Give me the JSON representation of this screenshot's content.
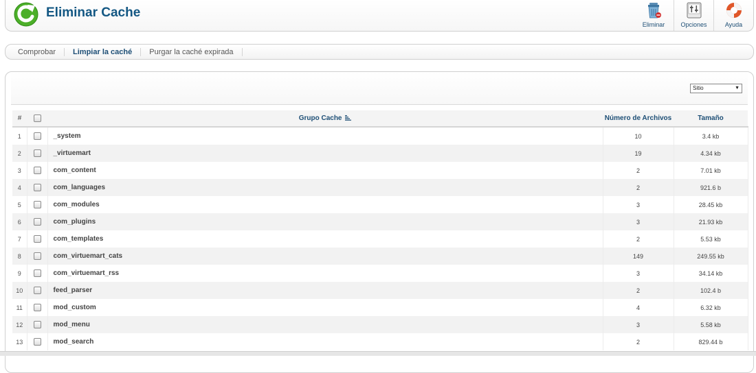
{
  "header": {
    "title": "Eliminar Cache",
    "toolbar": [
      {
        "label": "Eliminar",
        "icon": "trash-icon"
      },
      {
        "label": "Opciones",
        "icon": "options-icon"
      },
      {
        "label": "Ayuda",
        "icon": "help-lifebuoy-icon"
      }
    ]
  },
  "submenu": [
    {
      "label": "Comprobar",
      "active": false
    },
    {
      "label": "Limpiar la caché",
      "active": true
    },
    {
      "label": "Purgar la caché expirada",
      "active": false
    }
  ],
  "filter": {
    "selected": "Sitio"
  },
  "table": {
    "headers": {
      "num": "#",
      "group": "Grupo Cache",
      "files": "Número de Archivos",
      "size": "Tamaño"
    },
    "rows": [
      {
        "num": "1",
        "group": "_system",
        "files": "10",
        "size": "3.4 kb"
      },
      {
        "num": "2",
        "group": "_virtuemart",
        "files": "19",
        "size": "4.34 kb"
      },
      {
        "num": "3",
        "group": "com_content",
        "files": "2",
        "size": "7.01 kb"
      },
      {
        "num": "4",
        "group": "com_languages",
        "files": "2",
        "size": "921.6 b"
      },
      {
        "num": "5",
        "group": "com_modules",
        "files": "3",
        "size": "28.45 kb"
      },
      {
        "num": "6",
        "group": "com_plugins",
        "files": "3",
        "size": "21.93 kb"
      },
      {
        "num": "7",
        "group": "com_templates",
        "files": "2",
        "size": "5.53 kb"
      },
      {
        "num": "8",
        "group": "com_virtuemart_cats",
        "files": "149",
        "size": "249.55 kb"
      },
      {
        "num": "9",
        "group": "com_virtuemart_rss",
        "files": "3",
        "size": "34.14 kb"
      },
      {
        "num": "10",
        "group": "feed_parser",
        "files": "2",
        "size": "102.4 b"
      },
      {
        "num": "11",
        "group": "mod_custom",
        "files": "4",
        "size": "6.32 kb"
      },
      {
        "num": "12",
        "group": "mod_menu",
        "files": "3",
        "size": "5.58 kb"
      },
      {
        "num": "13",
        "group": "mod_search",
        "files": "2",
        "size": "829.44 b"
      }
    ]
  },
  "colors": {
    "title": "#135783",
    "link": "#1d4e75",
    "logo_green": "#4caf29"
  }
}
